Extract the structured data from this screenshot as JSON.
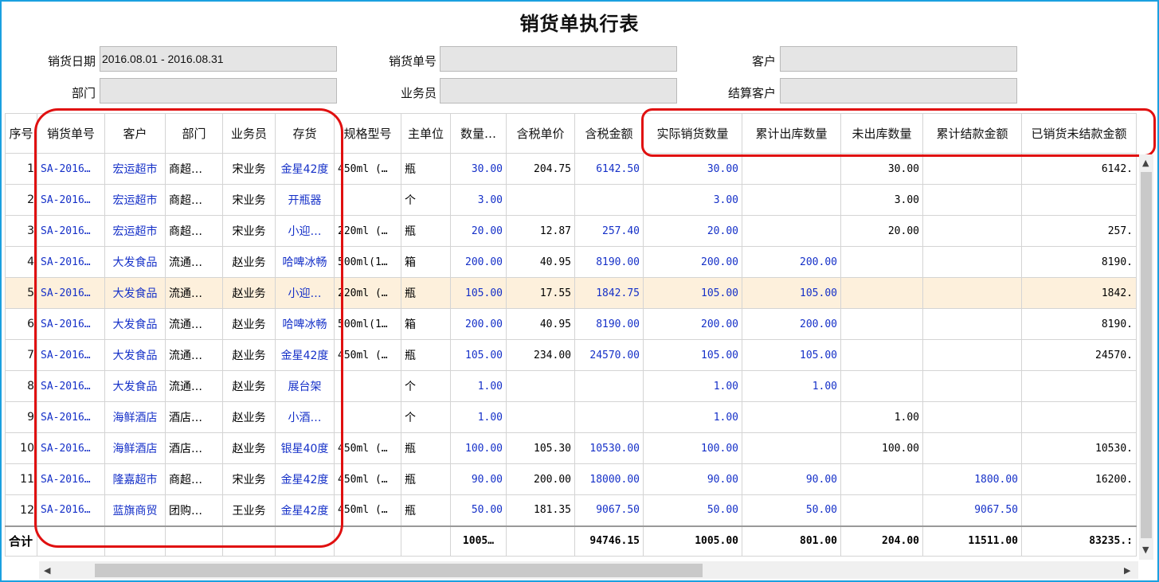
{
  "title": "销货单执行表",
  "filters": {
    "sale_date_label": "销货日期",
    "sale_date_value": "2016.08.01 - 2016.08.31",
    "order_no_label": "销货单号",
    "order_no_value": "",
    "customer_label": "客户",
    "customer_value": "",
    "dept_label": "部门",
    "dept_value": "",
    "salesman_label": "业务员",
    "salesman_value": "",
    "settle_customer_label": "结算客户",
    "settle_customer_value": ""
  },
  "columns": [
    "序号",
    "销货单号",
    "客户",
    "部门",
    "业务员",
    "存货",
    "规格型号",
    "主单位",
    "数量…",
    "含税单价",
    "含税金额",
    "实际销货数量",
    "累计出库数量",
    "未出库数量",
    "累计结款金额",
    "已销货未结款金额"
  ],
  "rows": [
    [
      "1",
      "SA-2016…",
      "宏运超市",
      "商超…",
      "宋业务",
      "金星42度",
      "450ml (…",
      "瓶",
      "30.00",
      "204.75",
      "6142.50",
      "30.00",
      "",
      "30.00",
      "",
      "6142."
    ],
    [
      "2",
      "SA-2016…",
      "宏运超市",
      "商超…",
      "宋业务",
      "开瓶器",
      "",
      "个",
      "3.00",
      "",
      "",
      "3.00",
      "",
      "3.00",
      "",
      ""
    ],
    [
      "3",
      "SA-2016…",
      "宏运超市",
      "商超…",
      "宋业务",
      "小迎…",
      "220ml (…",
      "瓶",
      "20.00",
      "12.87",
      "257.40",
      "20.00",
      "",
      "20.00",
      "",
      "257."
    ],
    [
      "4",
      "SA-2016…",
      "大发食品",
      "流通…",
      "赵业务",
      "哈啤冰畅",
      "500ml(1…",
      "箱",
      "200.00",
      "40.95",
      "8190.00",
      "200.00",
      "200.00",
      "",
      "",
      "8190."
    ],
    [
      "5",
      "SA-2016…",
      "大发食品",
      "流通…",
      "赵业务",
      "小迎…",
      "220ml (…",
      "瓶",
      "105.00",
      "17.55",
      "1842.75",
      "105.00",
      "105.00",
      "",
      "",
      "1842."
    ],
    [
      "6",
      "SA-2016…",
      "大发食品",
      "流通…",
      "赵业务",
      "哈啤冰畅",
      "500ml(1…",
      "箱",
      "200.00",
      "40.95",
      "8190.00",
      "200.00",
      "200.00",
      "",
      "",
      "8190."
    ],
    [
      "7",
      "SA-2016…",
      "大发食品",
      "流通…",
      "赵业务",
      "金星42度",
      "450ml (…",
      "瓶",
      "105.00",
      "234.00",
      "24570.00",
      "105.00",
      "105.00",
      "",
      "",
      "24570."
    ],
    [
      "8",
      "SA-2016…",
      "大发食品",
      "流通…",
      "赵业务",
      "展台架",
      "",
      "个",
      "1.00",
      "",
      "",
      "1.00",
      "1.00",
      "",
      "",
      ""
    ],
    [
      "9",
      "SA-2016…",
      "海鲜酒店",
      "酒店…",
      "赵业务",
      "小酒…",
      "",
      "个",
      "1.00",
      "",
      "",
      "1.00",
      "",
      "1.00",
      "",
      ""
    ],
    [
      "10",
      "SA-2016…",
      "海鲜酒店",
      "酒店…",
      "赵业务",
      "银星40度",
      "450ml (…",
      "瓶",
      "100.00",
      "105.30",
      "10530.00",
      "100.00",
      "",
      "100.00",
      "",
      "10530."
    ],
    [
      "11",
      "SA-2016…",
      "隆嘉超市",
      "商超…",
      "宋业务",
      "金星42度",
      "450ml (…",
      "瓶",
      "90.00",
      "200.00",
      "18000.00",
      "90.00",
      "90.00",
      "",
      "1800.00",
      "16200."
    ],
    [
      "12",
      "SA-2016…",
      "蓝旗商贸",
      "团购…",
      "王业务",
      "金星42度",
      "450ml (…",
      "瓶",
      "50.00",
      "181.35",
      "9067.50",
      "50.00",
      "50.00",
      "",
      "9067.50",
      ""
    ]
  ],
  "totals": [
    "合计",
    "",
    "",
    "",
    "",
    "",
    "",
    "",
    "1005…",
    "",
    "94746.15",
    "1005.00",
    "801.00",
    "204.00",
    "11511.00",
    "83235.:"
  ],
  "selected_row": 4,
  "colors": {
    "link_blue": "#1530c8",
    "highlight_red": "#e01010",
    "selected_row_bg": "#fdf0dc",
    "frame_border": "#1aa0e0"
  }
}
